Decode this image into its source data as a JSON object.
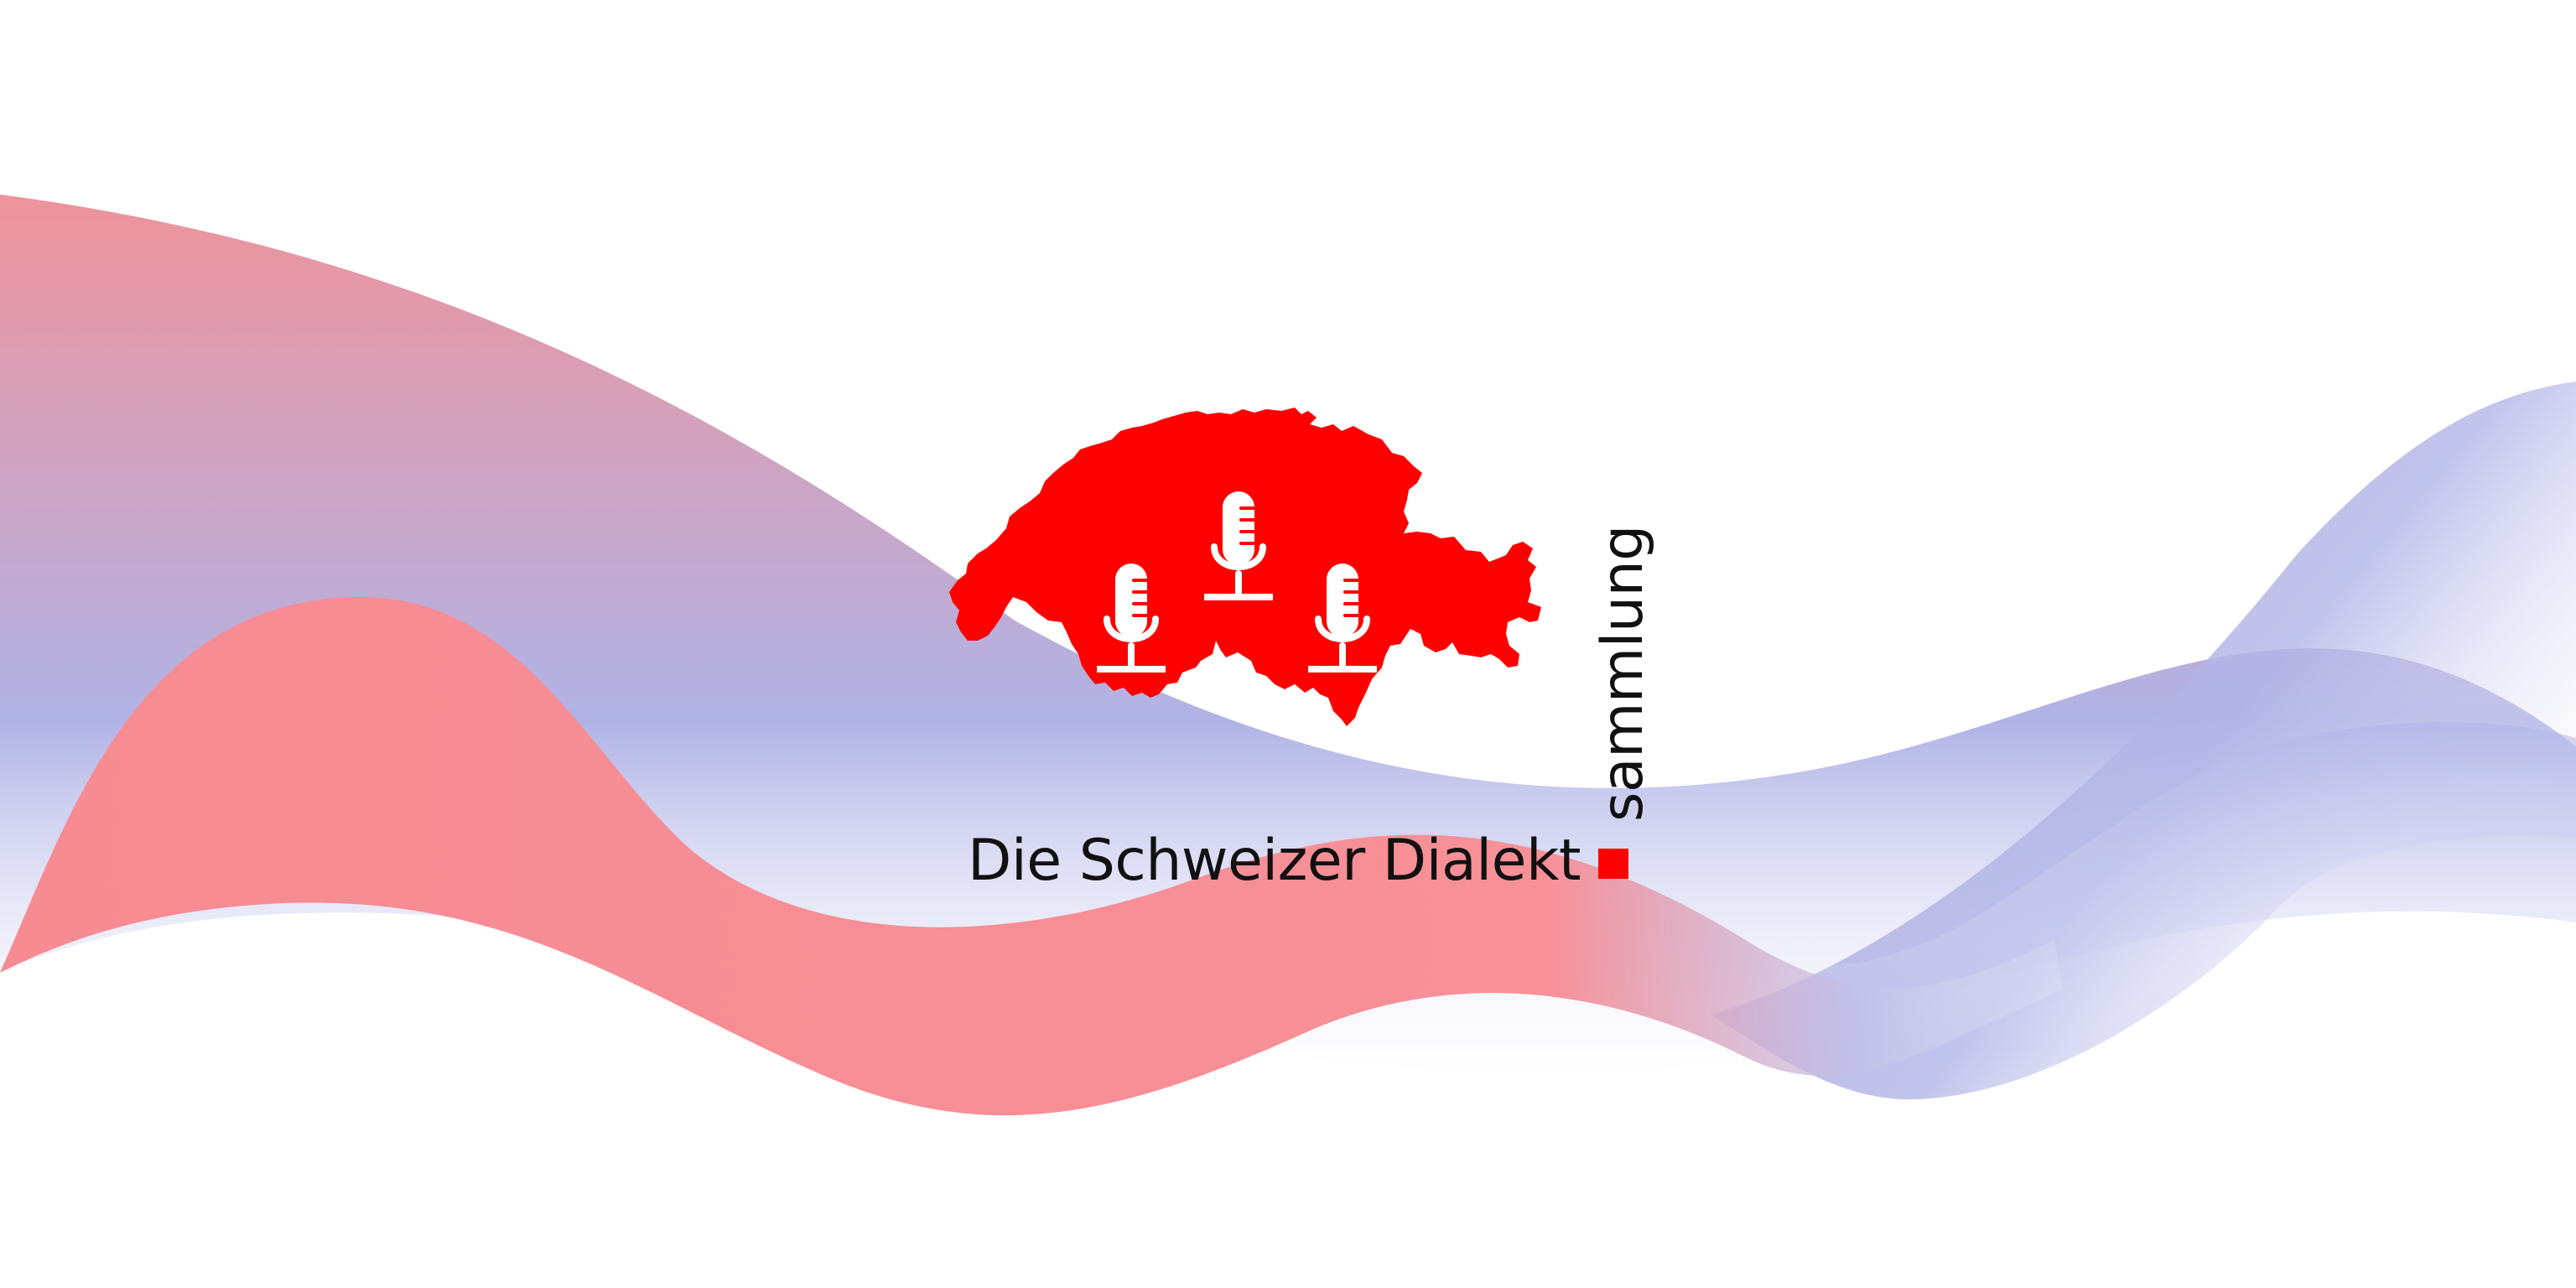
{
  "logo": {
    "line1": "Die Schweizer Dialekt",
    "line2": "sammlung",
    "icons": [
      "switzerland-map-icon",
      "microphone-icon",
      "microphone-icon",
      "microphone-icon"
    ]
  },
  "colors": {
    "brand_red": "#ff0000",
    "wave_pink": "#f78b92",
    "wave_lavender": "#b0b3e6",
    "text": "#111111",
    "background": "#ffffff"
  }
}
